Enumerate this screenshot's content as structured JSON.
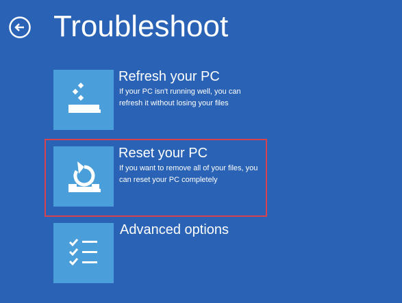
{
  "page": {
    "title": "Troubleshoot"
  },
  "back_button": {
    "icon": "back-arrow-icon"
  },
  "options": [
    {
      "title": "Refresh your PC",
      "description": "If your PC isn't running well, you can refresh it without losing your files",
      "icon": "refresh-pc-icon"
    },
    {
      "title": "Reset your PC",
      "description": "If you want to remove all of your files, you can reset your PC completely",
      "icon": "reset-pc-icon",
      "highlighted": true
    },
    {
      "title": "Advanced options",
      "icon": "advanced-options-icon"
    }
  ],
  "colors": {
    "background": "#2a63b5",
    "tile": "#4a9ed9",
    "highlight": "#d9434e",
    "text": "#ffffff"
  }
}
